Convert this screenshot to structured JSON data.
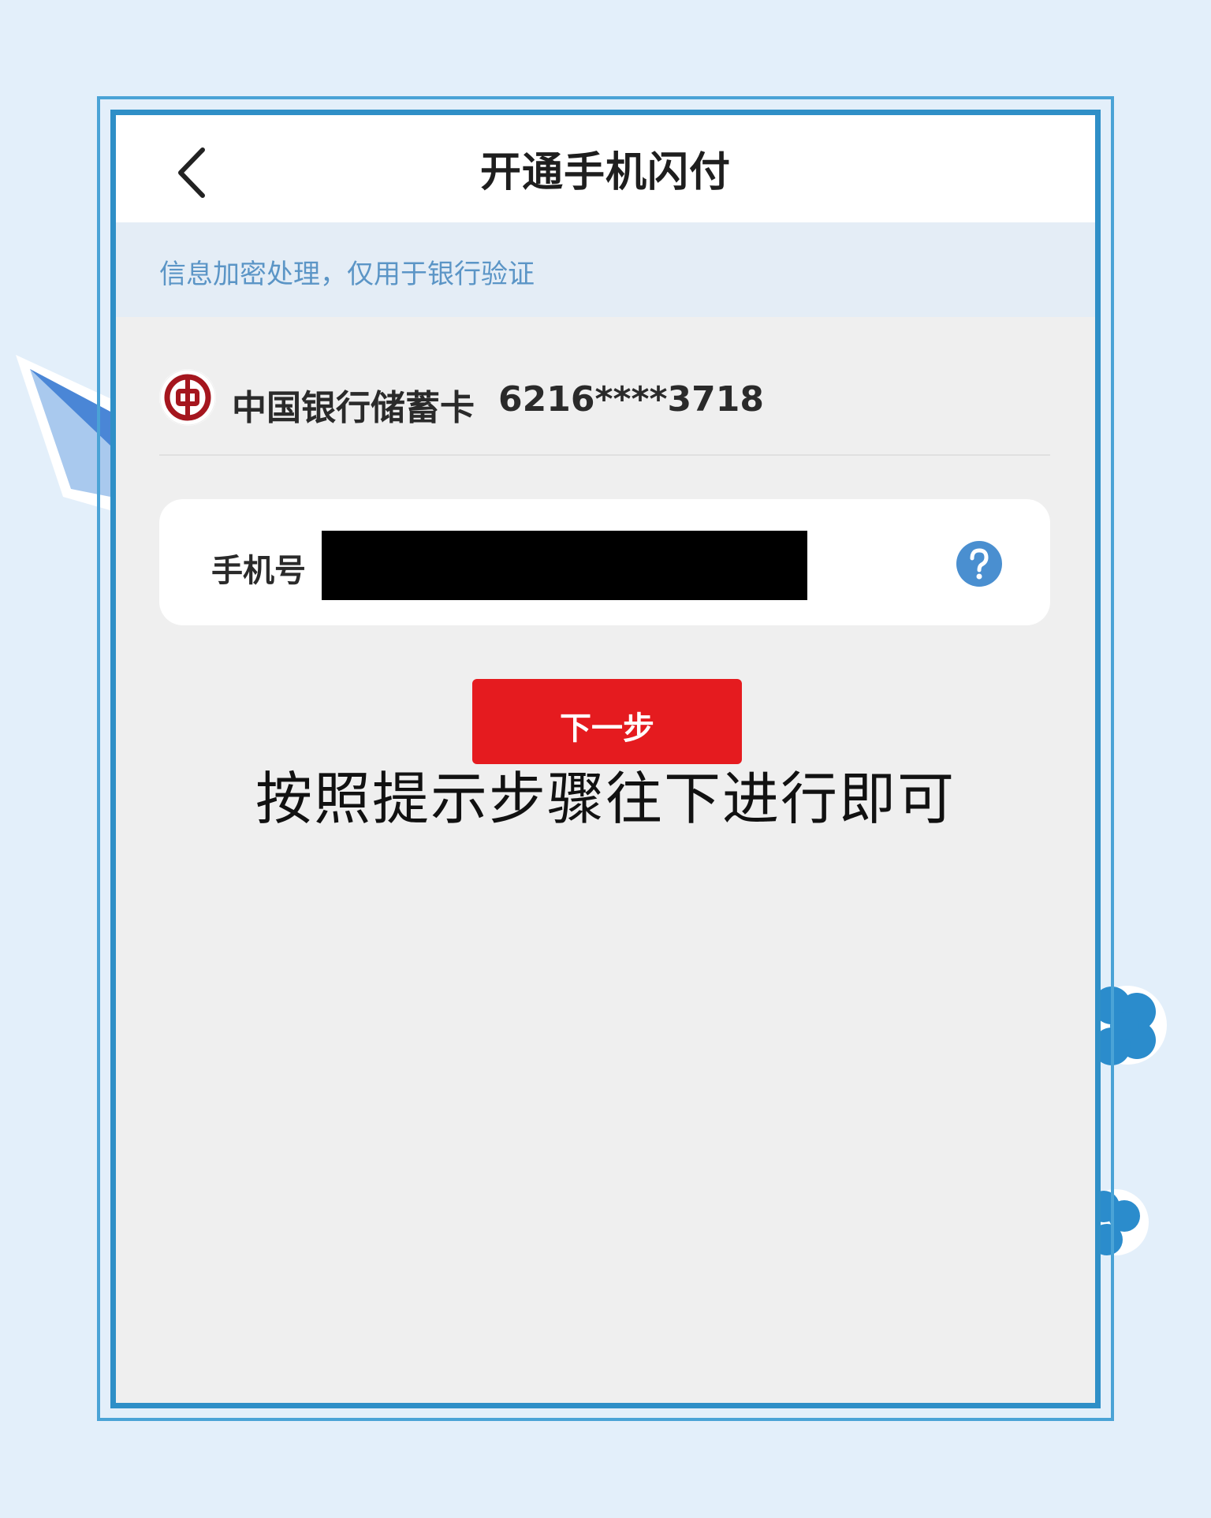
{
  "header": {
    "title": "开通手机闪付",
    "back_icon": "chevron-left-icon"
  },
  "notice": {
    "text": "信息加密处理，仅用于银行验证"
  },
  "card": {
    "bank_icon": "bank-of-china-logo-icon",
    "bank_name": "中国银行储蓄卡",
    "card_number": "6216****3718"
  },
  "phone": {
    "label": "手机号",
    "value": "",
    "redacted": true,
    "help_icon": "question-mark-icon"
  },
  "actions": {
    "next_label": "下一步"
  },
  "caption": {
    "text": "按照提示步骤往下进行即可"
  },
  "colors": {
    "page_background": "#e3effa",
    "frame_border": "#2f8fc7",
    "notice_text": "#5b95c6",
    "next_button": "#e51b1f",
    "help_icon": "#4a8fd0",
    "bank_logo": "#a5161e"
  }
}
